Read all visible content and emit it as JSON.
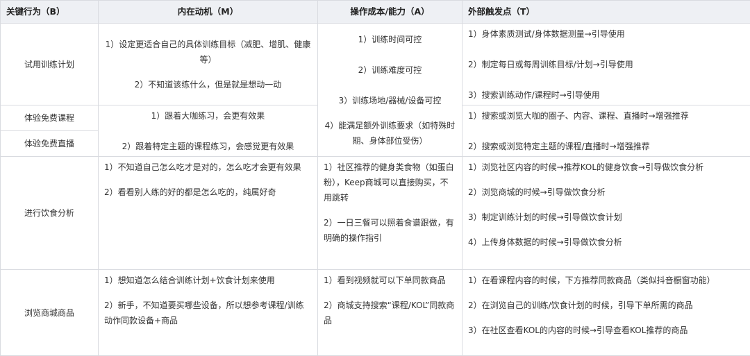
{
  "headers": {
    "b": "关键行为（B）",
    "m": "内在动机（M）",
    "a": "操作成本/能力（A）",
    "t": "外部触发点（T）"
  },
  "rows": {
    "trial": {
      "key": "试用训练计划",
      "m": [
        "1）设定更适合自己的具体训练目标（减肥、增肌、健康等）",
        "2）不知道该练什么，但是就是想动一动"
      ],
      "a": [
        "1）训练时间可控",
        "2）训练难度可控",
        "3）训练场地/器械/设备可控",
        "4）能满足额外训练要求（如特殊时期、身体部位受伤）"
      ],
      "t": [
        "1）身体素质测试/身体数据测量→引导使用",
        "2）制定每日或每周训练目标/计划→引导使用",
        "3）搜索训练动作/课程时→引导使用"
      ]
    },
    "course": {
      "key": "体验免费课程",
      "t": [
        "1）搜索或浏览大咖的圈子、内容、课程、直播时→增强推荐",
        "2）搜索或浏览特定主题的课程/直播时→增强推荐"
      ]
    },
    "live": {
      "key": "体验免费直播"
    },
    "shared_m": [
      "1）跟着大咖练习，会更有效果",
      "2）跟着特定主题的课程练习，会感觉更有效果"
    ],
    "diet": {
      "key": "进行饮食分析",
      "m": [
        "1）不知道自己怎么吃才是对的，怎么吃才会更有效果",
        "2）看看别人练的好的都是怎么吃的，纯属好奇"
      ],
      "a": [
        "1）社区推荐的健身类食物（如蛋白粉），Keep商城可以直接购买，不用跳转",
        "2）一日三餐可以照着食谱跟做，有明确的操作指引"
      ],
      "t": [
        "1）浏览社区内容的时候→推荐KOL的健身饮食→引导做饮食分析",
        "2）浏览商城的时候→引导做饮食分析",
        "3）制定训练计划的时候→引导做饮食计划",
        "4）上传身体数据的时候→引导做饮食分析"
      ]
    },
    "shop": {
      "key": "浏览商城商品",
      "m": [
        "1）想知道怎么结合训练计划+饮食计划来使用",
        "2）新手，不知道要买哪些设备，所以想参考课程/训练动作同款设备+商品"
      ],
      "a": [
        "1）看到视频就可以下单同款商品",
        "2）商城支持搜索“课程/KOL”同款商品"
      ],
      "t": [
        "1）在看课程内容的时候，下方推荐同款商品（类似抖音橱窗功能）",
        "2）在浏览自己的训练/饮食计划的时候，引导下单所需的商品",
        "3）在社区查看KOL的内容的时候→引导查看KOL推荐的商品"
      ]
    }
  }
}
